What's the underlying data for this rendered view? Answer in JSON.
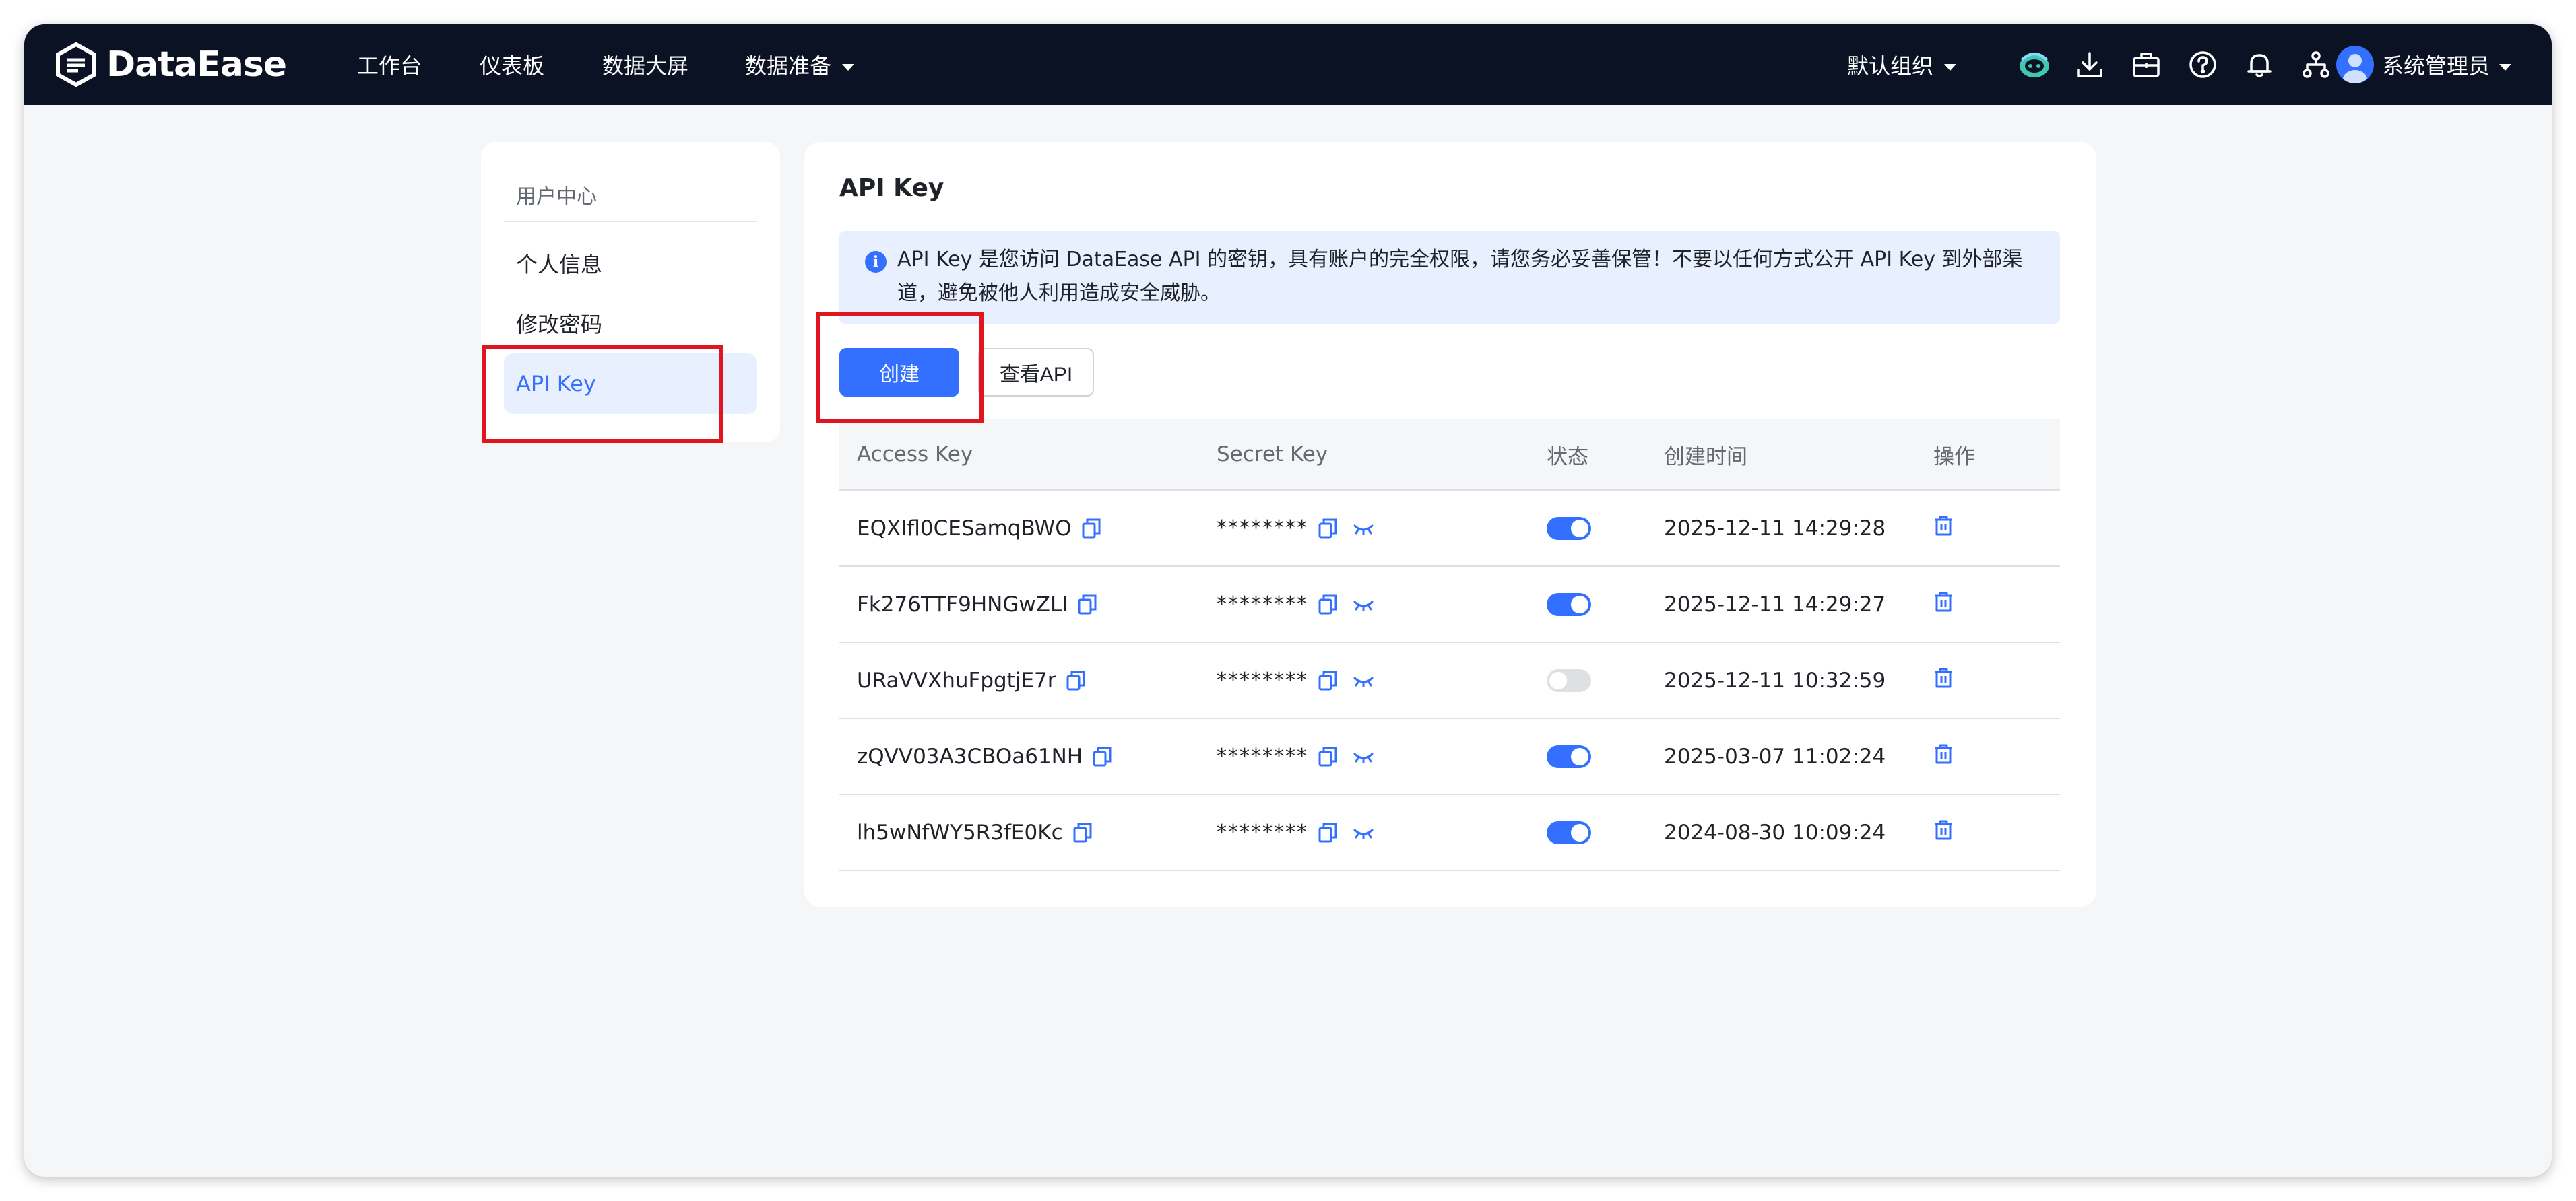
{
  "app": {
    "logo_text": "DataEase"
  },
  "nav": {
    "items": [
      {
        "label": "工作台"
      },
      {
        "label": "仪表板"
      },
      {
        "label": "数据大屏"
      },
      {
        "label": "数据准备"
      }
    ],
    "org_label": "默认组织",
    "user_label": "系统管理员"
  },
  "sidebar": {
    "title": "用户中心",
    "items": [
      {
        "label": "个人信息"
      },
      {
        "label": "修改密码"
      },
      {
        "label": "API Key"
      }
    ]
  },
  "main": {
    "title": "API Key",
    "alert_text": "API Key 是您访问 DataEase API 的密钥，具有账户的完全权限，请您务必妥善保管！不要以任何方式公开 API Key 到外部渠道，避免被他人利用造成安全威胁。",
    "create_button": "创建",
    "view_api_button": "查看API",
    "table": {
      "headers": [
        "Access Key",
        "Secret Key",
        "状态",
        "创建时间",
        "操作"
      ],
      "rows": [
        {
          "access_key": "EQXIfl0CESamqBWO",
          "secret": "********",
          "enabled": true,
          "created": "2025-12-11 14:29:28"
        },
        {
          "access_key": "Fk276TTF9HNGwZLI",
          "secret": "********",
          "enabled": true,
          "created": "2025-12-11 14:29:27"
        },
        {
          "access_key": "URaVVXhuFpgtjE7r",
          "secret": "********",
          "enabled": false,
          "created": "2025-12-11 10:32:59"
        },
        {
          "access_key": "zQVV03A3CBOa61NH",
          "secret": "********",
          "enabled": true,
          "created": "2025-03-07 11:02:24"
        },
        {
          "access_key": "lh5wNfWY5R3fE0Kc",
          "secret": "********",
          "enabled": true,
          "created": "2024-08-30 10:09:24"
        }
      ]
    }
  },
  "theme": {
    "accent": "#3370ff",
    "topbar": "#0b1224",
    "highlight": "#e0151f"
  },
  "icons": [
    "logo-icon",
    "ai-assistant-icon",
    "download-icon",
    "briefcase-icon",
    "help-icon",
    "bell-icon",
    "org-tree-icon",
    "info-icon",
    "copy-icon",
    "eye-closed-icon",
    "delete-icon",
    "chevron-down-icon"
  ]
}
